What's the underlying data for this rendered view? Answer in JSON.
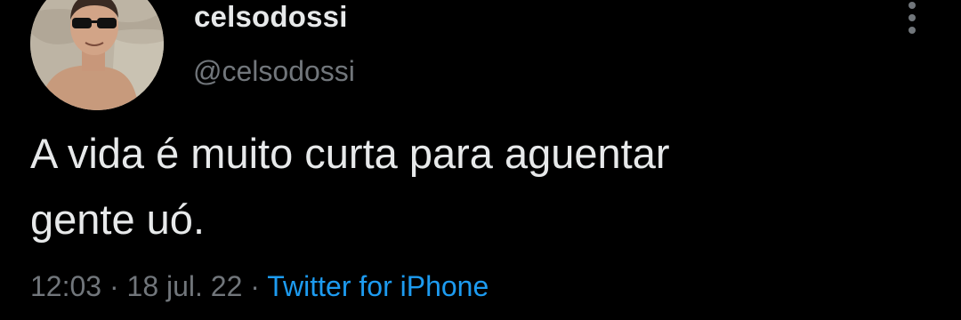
{
  "tweet": {
    "author": {
      "display_name": "celsodossi",
      "handle": "@celsodossi",
      "avatar_icon": "profile-photo"
    },
    "text_lines": [
      "A vida é muito curta para aguentar",
      "gente uó."
    ],
    "time": "12:03",
    "separator": "·",
    "date": "18 jul. 22",
    "source": "Twitter for iPhone"
  },
  "colors": {
    "background": "#000000",
    "primary_text": "#e7e9ea",
    "secondary_text": "#71767b",
    "link": "#1d9bf0"
  },
  "icons": {
    "more": "more-vertical-icon"
  }
}
